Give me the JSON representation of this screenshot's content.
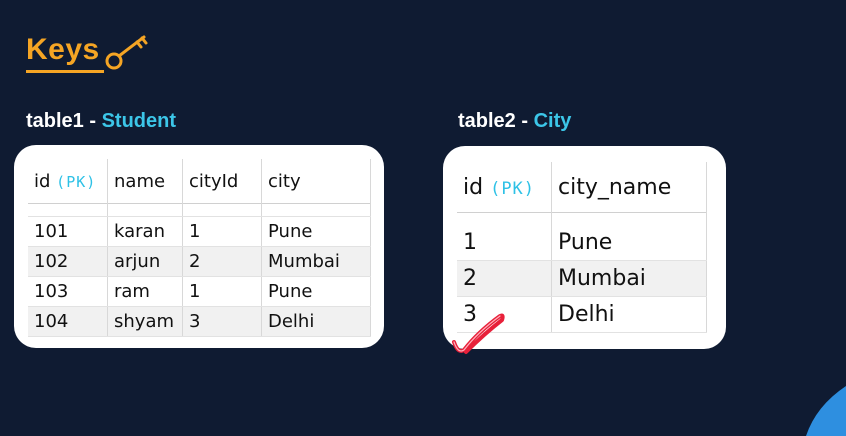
{
  "page": {
    "title": "Keys"
  },
  "table1": {
    "label": "table1 - ",
    "label_accent": "Student",
    "headers": {
      "id": "id",
      "pk": "(PK)",
      "name": "name",
      "cityId": "cityId",
      "city": "city"
    },
    "rows": [
      {
        "id": "101",
        "name": "karan",
        "cityId": "1",
        "city": "Pune"
      },
      {
        "id": "102",
        "name": "arjun",
        "cityId": "2",
        "city": "Mumbai"
      },
      {
        "id": "103",
        "name": "ram",
        "cityId": "1",
        "city": "Pune"
      },
      {
        "id": "104",
        "name": "shyam",
        "cityId": "3",
        "city": "Delhi"
      }
    ]
  },
  "table2": {
    "label": "table2 - ",
    "label_accent": "City",
    "headers": {
      "id": "id",
      "pk": "(PK)",
      "city_name": "city_name"
    },
    "rows": [
      {
        "id": "1",
        "city_name": "Pune"
      },
      {
        "id": "2",
        "city_name": "Mumbai"
      },
      {
        "id": "3",
        "city_name": "Delhi"
      }
    ]
  },
  "colors": {
    "background": "#0f1b32",
    "title": "#f5a524",
    "accent": "#3cc6e8",
    "check": "#e8203a"
  }
}
